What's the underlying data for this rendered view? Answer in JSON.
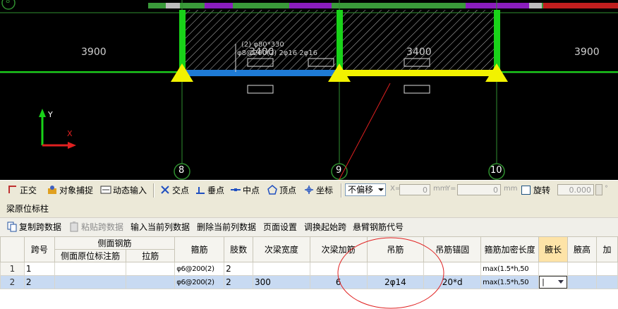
{
  "canvas": {
    "axes_label": "8",
    "grid_labels": [
      "8",
      "9",
      "10"
    ],
    "span_labels": [
      "3900",
      "3400",
      "3400",
      "3900"
    ],
    "beam_annotation_top": "(2) φ80*330",
    "beam_annotation_mid": "φ8@200(2) 2φ16 2φ16",
    "axis_y": "Y",
    "axis_x": "X"
  },
  "snapbar": {
    "ortho": "正交",
    "snap": "对象捕捉",
    "dynamic": "动态输入",
    "intersection": "交点",
    "perpendicular": "垂点",
    "midpoint": "中点",
    "vertex": "顶点",
    "coordinate": "坐标",
    "offset_mode": "不偏移",
    "x_label": "X=",
    "x_value": "0",
    "y_label": "Y=",
    "y_value": "0",
    "unit": "mm",
    "rotate": "旋转",
    "rotate_value": "0.000",
    "degree": "°"
  },
  "panel": {
    "title": "梁原位标柱"
  },
  "commands": {
    "copy": "复制跨数据",
    "paste": "粘贴跨数据",
    "input_col": "输入当前列数据",
    "delete_col": "删除当前列数据",
    "page_setup": "页面设置",
    "swap_start": "调换起始跨",
    "cantilever": "悬臂钢筋代号"
  },
  "table": {
    "headers": {
      "span_no": "跨号",
      "side_rebar": "侧面钢筋",
      "side_annot": "侧面原位标注筋",
      "tie": "拉筋",
      "stirrup": "箍筋",
      "legs": "肢数",
      "sec_width": "次梁宽度",
      "sec_add": "次梁加筋",
      "hanger": "吊筋",
      "hanger_anchor": "吊筋锚固",
      "dense_len": "箍筋加密长度",
      "haunch_len": "腋长",
      "haunch_h": "腋高",
      "more": "加"
    },
    "rows": [
      {
        "idx": "1",
        "span": "1",
        "side_annot": "",
        "tie": "",
        "stirrup": "φ6@200(2)",
        "legs": "2",
        "sec_width": "",
        "sec_add": "",
        "hanger": "",
        "anchor": "",
        "dense": "max(1.5*h,50",
        "haunch_len": "",
        "haunch_h": ""
      },
      {
        "idx": "2",
        "span": "2",
        "side_annot": "",
        "tie": "",
        "stirrup": "φ6@200(2)",
        "legs": "2",
        "sec_width": "300",
        "sec_add": "6",
        "hanger": "2φ14",
        "anchor": "20*d",
        "dense": "max(1.5*h,50",
        "haunch_len": "|",
        "haunch_h": ""
      }
    ]
  },
  "colors": {
    "beam_yellow": "#f2f200",
    "beam_blue": "#1e7bd6",
    "column_green": "#19d219",
    "annotation_red": "#e02020"
  }
}
